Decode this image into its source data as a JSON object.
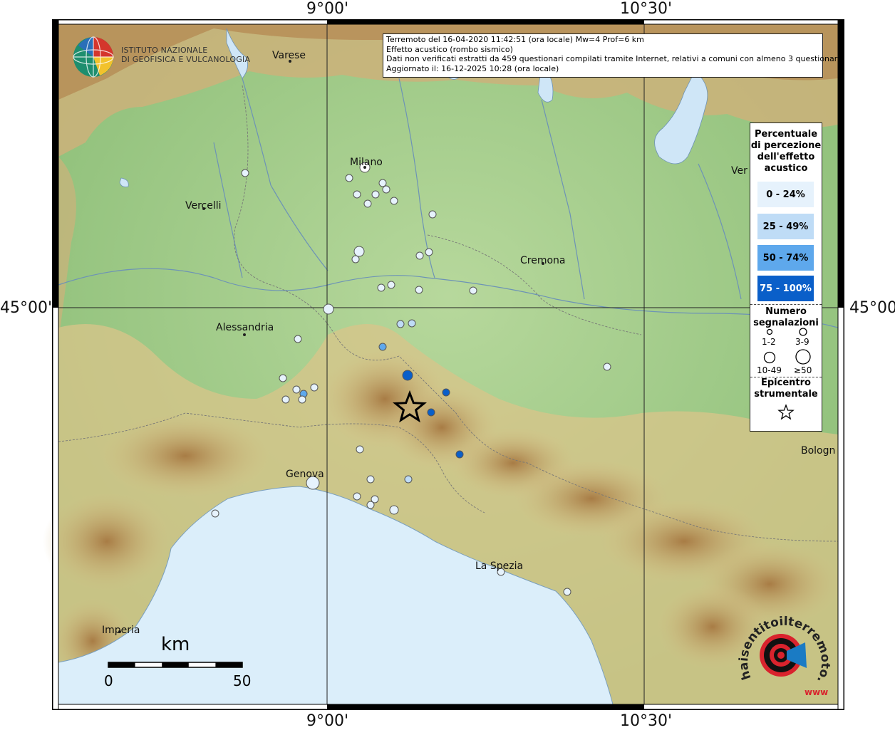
{
  "info": {
    "line1": "Terremoto del 16-04-2020 11:42:51 (ora locale) Mw=4 Prof=6 km",
    "line2": "Effetto acustico (rombo sismico)",
    "line3": "Dati non verificati estratti da 459 questionari compilati tramite Internet, relativi a comuni con almeno 3 questionari.",
    "line4": "Aggiornato il: 16-12-2025 10:28 (ora locale)"
  },
  "logo": {
    "line1": "ISTITUTO NAZIONALE",
    "line2": "DI GEOFISICA E VULCANOLOGIA"
  },
  "axes": {
    "top_left": "9°00'",
    "top_right": "10°30'",
    "bottom_left": "9°00'",
    "bottom_right": "10°30'",
    "left_lat": "45°00'",
    "right_lat": "45°00'"
  },
  "cities": {
    "varese": "Varese",
    "milano": "Milano",
    "vercelli": "Vercelli",
    "cremona": "Cremona",
    "alessandria": "Alessandria",
    "genova": "Genova",
    "la_spezia": "La Spezia",
    "imperia": "Imperia",
    "bologna": "Bologn",
    "verona": "Ver"
  },
  "legend": {
    "title_lines": [
      "Percentuale",
      "di percezione",
      "dell'effetto",
      "acustico"
    ],
    "classes": [
      {
        "label": "0 - 24%",
        "color": "#e6f2fc"
      },
      {
        "label": "25 - 49%",
        "color": "#bfdcf6"
      },
      {
        "label": "50 - 74%",
        "color": "#5ea8ec"
      },
      {
        "label": "75 - 100%",
        "color": "#0a5fc9"
      }
    ],
    "count_title_lines": [
      "Numero",
      "segnalazioni"
    ],
    "count_classes": [
      "1-2",
      "3-9",
      "10-49",
      "≥50"
    ],
    "epicenter_lines": [
      "Epicentro",
      "strumentale"
    ]
  },
  "scale": {
    "title": "km",
    "start": "0",
    "end": "50"
  },
  "hst_logo": {
    "text": "haisentitoilterremoto.it",
    "www": "www"
  },
  "colors": {
    "sea": "#dbeefa",
    "plain": "#a8cf8f",
    "hills": "#d9c48a",
    "mountains": "#b88a4e",
    "pct_0_24": "#e6f2fc",
    "pct_25_49": "#bfdcf6",
    "pct_50_74": "#5ea8ec",
    "pct_75_100": "#0a5fc9"
  }
}
